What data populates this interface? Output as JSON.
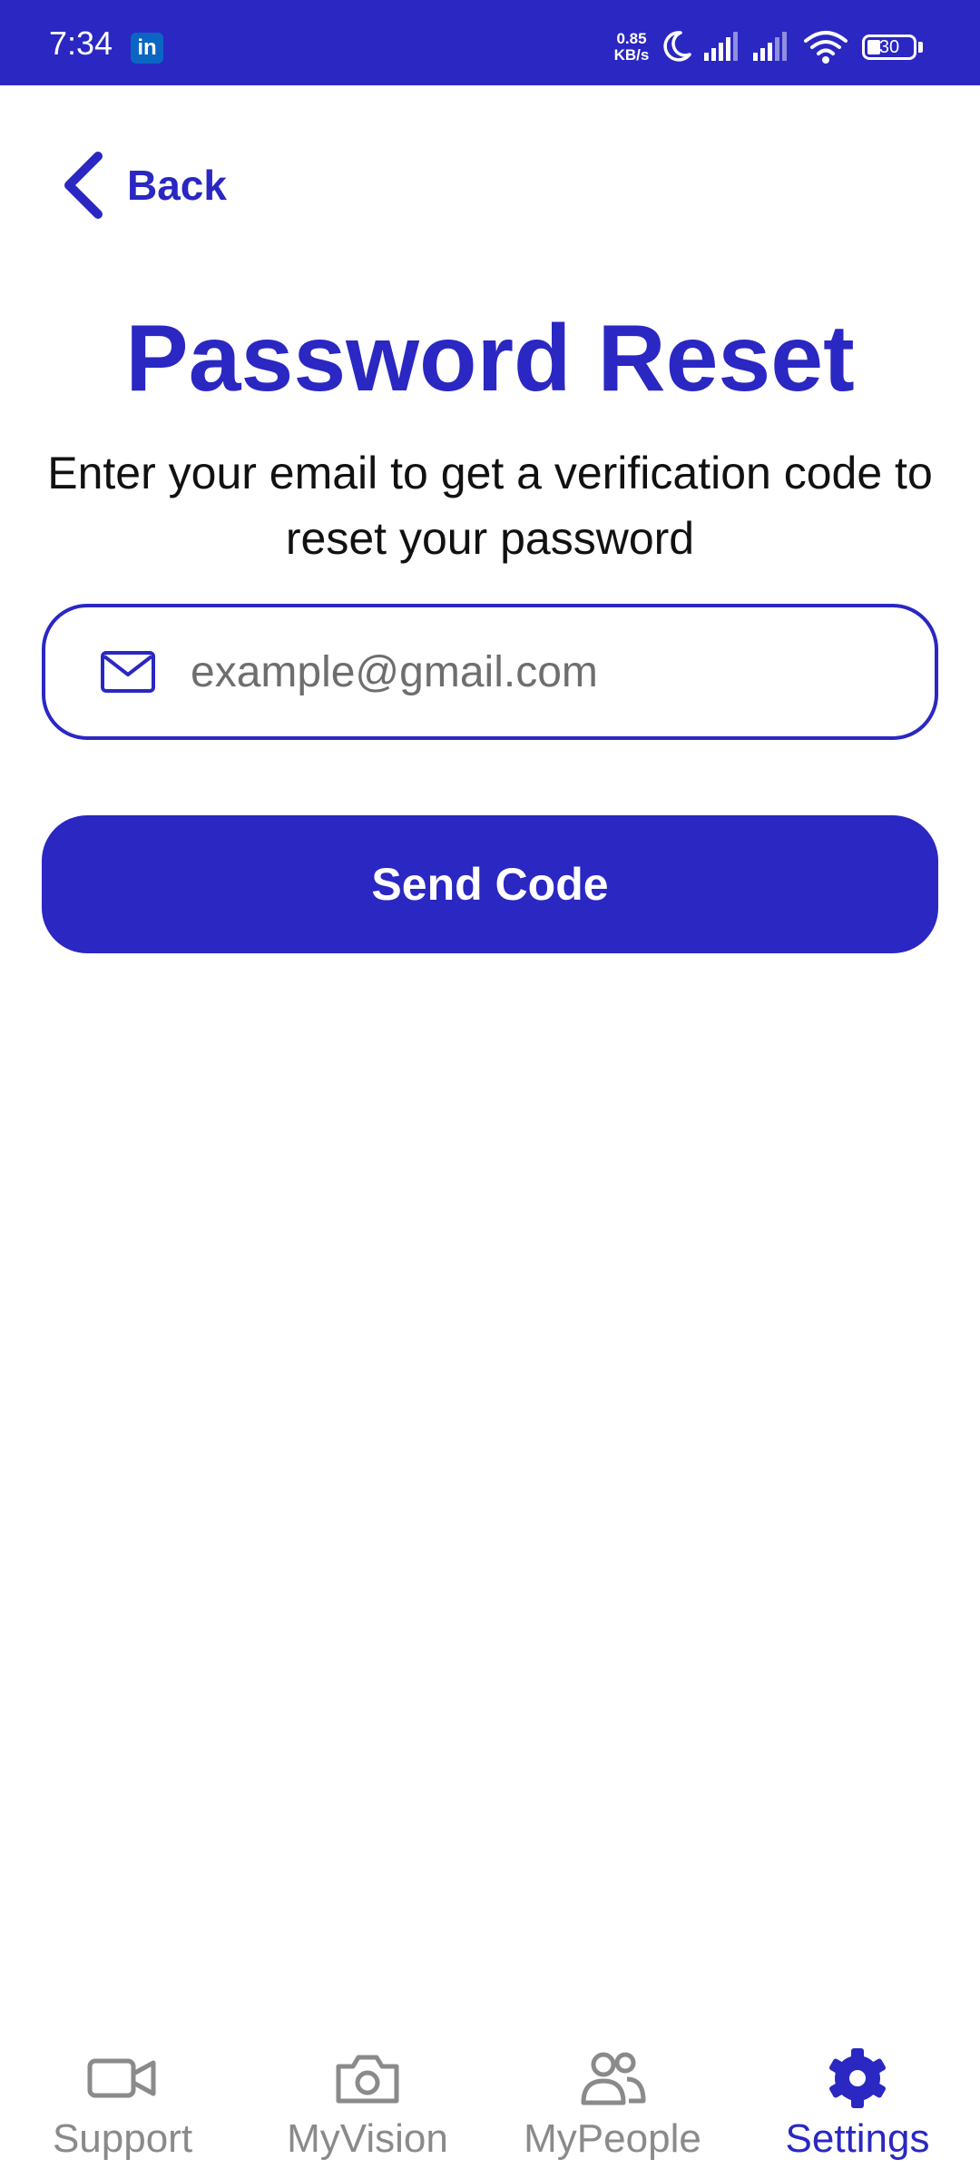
{
  "status_bar": {
    "time": "7:34",
    "notification_badge": "in",
    "net_speed_value": "0.85",
    "net_speed_unit": "KB/s",
    "battery_level": "30",
    "icons": [
      "linkedin-icon",
      "moon-icon",
      "signal-icon",
      "signal-icon",
      "wifi-icon",
      "battery-icon"
    ]
  },
  "header": {
    "back_label": "Back"
  },
  "main": {
    "title": "Password Reset",
    "subtitle": "Enter your email to get a verification code to reset your password",
    "email_placeholder": "example@gmail.com",
    "email_value": "",
    "send_button_label": "Send Code"
  },
  "bottom_nav": {
    "items": [
      {
        "label": "Support",
        "icon": "video-camera-icon",
        "active": false
      },
      {
        "label": "MyVision",
        "icon": "camera-icon",
        "active": false
      },
      {
        "label": "MyPeople",
        "icon": "people-icon",
        "active": false
      },
      {
        "label": "Settings",
        "icon": "gear-icon",
        "active": true
      }
    ]
  },
  "colors": {
    "primary": "#2a27c3",
    "inactive": "#8a8a8a",
    "background": "#ffffff"
  }
}
